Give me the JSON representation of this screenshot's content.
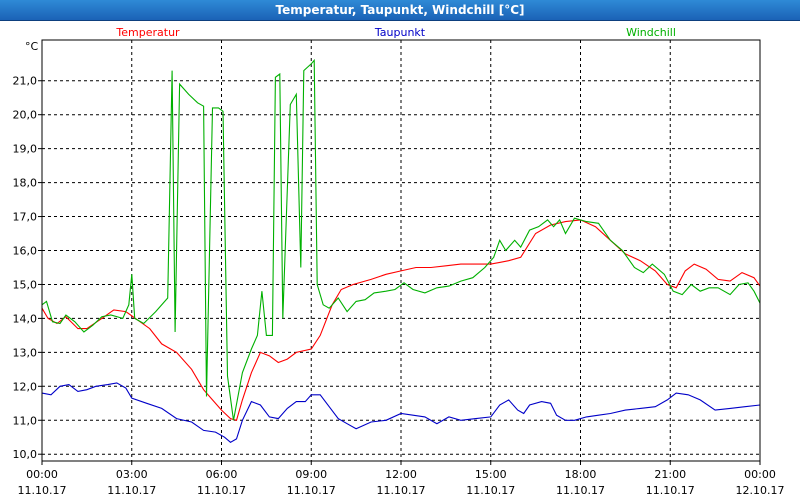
{
  "window": {
    "title": "Temperatur, Taupunkt, Windchill [°C]"
  },
  "chart_data": {
    "type": "line",
    "title": "Temperatur, Taupunkt, Windchill [°C]",
    "y_unit_label": "°C",
    "ylim": [
      9.8,
      22.2
    ],
    "xlim_hours": [
      0,
      24
    ],
    "y_ticks": [
      "10,0",
      "11,0",
      "12,0",
      "13,0",
      "14,0",
      "15,0",
      "16,0",
      "17,0",
      "18,0",
      "19,0",
      "20,0",
      "21,0"
    ],
    "x_ticks": [
      {
        "time": "00:00",
        "date": "11.10.17"
      },
      {
        "time": "03:00",
        "date": "11.10.17"
      },
      {
        "time": "06:00",
        "date": "11.10.17"
      },
      {
        "time": "09:00",
        "date": "11.10.17"
      },
      {
        "time": "12:00",
        "date": "11.10.17"
      },
      {
        "time": "15:00",
        "date": "11.10.17"
      },
      {
        "time": "18:00",
        "date": "11.10.17"
      },
      {
        "time": "21:00",
        "date": "11.10.17"
      },
      {
        "time": "00:00",
        "date": "12.10.17"
      }
    ],
    "grid": true,
    "series": [
      {
        "name": "Temperatur",
        "color": "#ff0000",
        "points": [
          [
            0.0,
            14.3
          ],
          [
            0.2,
            14.0
          ],
          [
            0.5,
            13.85
          ],
          [
            0.8,
            14.05
          ],
          [
            1.2,
            13.7
          ],
          [
            1.5,
            13.7
          ],
          [
            2.0,
            14.0
          ],
          [
            2.4,
            14.25
          ],
          [
            2.8,
            14.2
          ],
          [
            3.2,
            13.95
          ],
          [
            3.6,
            13.7
          ],
          [
            4.0,
            13.25
          ],
          [
            4.5,
            13.0
          ],
          [
            5.0,
            12.5
          ],
          [
            5.4,
            11.9
          ],
          [
            5.7,
            11.6
          ],
          [
            6.0,
            11.3
          ],
          [
            6.3,
            11.05
          ],
          [
            6.5,
            11.0
          ],
          [
            6.7,
            11.6
          ],
          [
            7.0,
            12.4
          ],
          [
            7.3,
            13.0
          ],
          [
            7.6,
            12.9
          ],
          [
            7.9,
            12.7
          ],
          [
            8.2,
            12.8
          ],
          [
            8.5,
            13.0
          ],
          [
            9.0,
            13.1
          ],
          [
            9.3,
            13.5
          ],
          [
            9.7,
            14.4
          ],
          [
            10.0,
            14.85
          ],
          [
            10.4,
            15.0
          ],
          [
            11.0,
            15.15
          ],
          [
            11.5,
            15.3
          ],
          [
            12.0,
            15.4
          ],
          [
            12.5,
            15.5
          ],
          [
            13.0,
            15.5
          ],
          [
            13.5,
            15.55
          ],
          [
            14.0,
            15.6
          ],
          [
            14.5,
            15.6
          ],
          [
            15.0,
            15.6
          ],
          [
            15.3,
            15.65
          ],
          [
            15.6,
            15.7
          ],
          [
            16.0,
            15.8
          ],
          [
            16.5,
            16.5
          ],
          [
            17.0,
            16.75
          ],
          [
            17.5,
            16.85
          ],
          [
            18.0,
            16.9
          ],
          [
            18.5,
            16.7
          ],
          [
            19.0,
            16.3
          ],
          [
            19.5,
            15.9
          ],
          [
            20.0,
            15.7
          ],
          [
            20.5,
            15.4
          ],
          [
            20.9,
            15.0
          ],
          [
            21.2,
            14.9
          ],
          [
            21.5,
            15.4
          ],
          [
            21.8,
            15.6
          ],
          [
            22.2,
            15.45
          ],
          [
            22.6,
            15.15
          ],
          [
            23.0,
            15.1
          ],
          [
            23.4,
            15.35
          ],
          [
            23.8,
            15.2
          ],
          [
            24.0,
            14.95
          ]
        ]
      },
      {
        "name": "Taupunkt",
        "color": "#0000c8",
        "points": [
          [
            0.0,
            11.8
          ],
          [
            0.3,
            11.75
          ],
          [
            0.6,
            12.0
          ],
          [
            0.9,
            12.05
          ],
          [
            1.2,
            11.85
          ],
          [
            1.5,
            11.9
          ],
          [
            1.8,
            12.0
          ],
          [
            2.2,
            12.05
          ],
          [
            2.5,
            12.1
          ],
          [
            2.8,
            11.95
          ],
          [
            3.0,
            11.65
          ],
          [
            3.5,
            11.5
          ],
          [
            4.0,
            11.35
          ],
          [
            4.5,
            11.05
          ],
          [
            5.0,
            10.95
          ],
          [
            5.4,
            10.7
          ],
          [
            5.8,
            10.65
          ],
          [
            6.1,
            10.5
          ],
          [
            6.3,
            10.35
          ],
          [
            6.5,
            10.45
          ],
          [
            6.7,
            11.0
          ],
          [
            7.0,
            11.55
          ],
          [
            7.3,
            11.45
          ],
          [
            7.6,
            11.1
          ],
          [
            7.9,
            11.05
          ],
          [
            8.2,
            11.35
          ],
          [
            8.5,
            11.55
          ],
          [
            8.8,
            11.55
          ],
          [
            9.0,
            11.75
          ],
          [
            9.3,
            11.75
          ],
          [
            9.6,
            11.4
          ],
          [
            9.9,
            11.05
          ],
          [
            10.2,
            10.9
          ],
          [
            10.5,
            10.75
          ],
          [
            11.0,
            10.95
          ],
          [
            11.5,
            11.0
          ],
          [
            12.0,
            11.2
          ],
          [
            12.4,
            11.15
          ],
          [
            12.8,
            11.1
          ],
          [
            13.2,
            10.9
          ],
          [
            13.6,
            11.1
          ],
          [
            14.0,
            11.0
          ],
          [
            14.5,
            11.05
          ],
          [
            15.0,
            11.1
          ],
          [
            15.3,
            11.45
          ],
          [
            15.6,
            11.6
          ],
          [
            15.9,
            11.3
          ],
          [
            16.1,
            11.2
          ],
          [
            16.3,
            11.45
          ],
          [
            16.7,
            11.55
          ],
          [
            17.0,
            11.5
          ],
          [
            17.2,
            11.15
          ],
          [
            17.5,
            11.0
          ],
          [
            17.8,
            11.0
          ],
          [
            18.2,
            11.1
          ],
          [
            18.6,
            11.15
          ],
          [
            19.0,
            11.2
          ],
          [
            19.5,
            11.3
          ],
          [
            20.0,
            11.35
          ],
          [
            20.5,
            11.4
          ],
          [
            20.9,
            11.6
          ],
          [
            21.2,
            11.8
          ],
          [
            21.6,
            11.75
          ],
          [
            22.0,
            11.6
          ],
          [
            22.5,
            11.3
          ],
          [
            23.0,
            11.35
          ],
          [
            23.5,
            11.4
          ],
          [
            24.0,
            11.45
          ]
        ]
      },
      {
        "name": "Windchill",
        "color": "#00b000",
        "points": [
          [
            0.0,
            14.4
          ],
          [
            0.15,
            14.5
          ],
          [
            0.35,
            13.9
          ],
          [
            0.6,
            13.85
          ],
          [
            0.8,
            14.1
          ],
          [
            1.1,
            13.9
          ],
          [
            1.4,
            13.6
          ],
          [
            1.7,
            13.8
          ],
          [
            2.0,
            14.05
          ],
          [
            2.3,
            14.1
          ],
          [
            2.7,
            14.0
          ],
          [
            2.9,
            14.4
          ],
          [
            3.0,
            15.3
          ],
          [
            3.1,
            14.0
          ],
          [
            3.4,
            13.85
          ],
          [
            3.8,
            14.2
          ],
          [
            4.2,
            14.6
          ],
          [
            4.35,
            21.3
          ],
          [
            4.45,
            13.6
          ],
          [
            4.6,
            20.9
          ],
          [
            4.9,
            20.6
          ],
          [
            5.2,
            20.35
          ],
          [
            5.4,
            20.25
          ],
          [
            5.5,
            11.7
          ],
          [
            5.7,
            20.2
          ],
          [
            5.9,
            20.2
          ],
          [
            6.05,
            20.1
          ],
          [
            6.2,
            12.3
          ],
          [
            6.4,
            11.0
          ],
          [
            6.7,
            12.4
          ],
          [
            7.0,
            13.1
          ],
          [
            7.2,
            13.5
          ],
          [
            7.35,
            14.8
          ],
          [
            7.5,
            13.5
          ],
          [
            7.7,
            13.5
          ],
          [
            7.8,
            21.1
          ],
          [
            7.95,
            21.2
          ],
          [
            8.05,
            14.0
          ],
          [
            8.3,
            20.3
          ],
          [
            8.5,
            20.6
          ],
          [
            8.65,
            15.5
          ],
          [
            8.75,
            21.3
          ],
          [
            9.0,
            21.5
          ],
          [
            9.1,
            21.6
          ],
          [
            9.2,
            15.0
          ],
          [
            9.4,
            14.4
          ],
          [
            9.6,
            14.3
          ],
          [
            9.9,
            14.6
          ],
          [
            10.2,
            14.2
          ],
          [
            10.5,
            14.5
          ],
          [
            10.8,
            14.55
          ],
          [
            11.1,
            14.75
          ],
          [
            11.5,
            14.8
          ],
          [
            11.8,
            14.85
          ],
          [
            12.1,
            15.05
          ],
          [
            12.4,
            14.85
          ],
          [
            12.8,
            14.75
          ],
          [
            13.2,
            14.9
          ],
          [
            13.6,
            14.95
          ],
          [
            14.0,
            15.1
          ],
          [
            14.4,
            15.2
          ],
          [
            14.8,
            15.5
          ],
          [
            15.1,
            15.8
          ],
          [
            15.3,
            16.3
          ],
          [
            15.5,
            16.0
          ],
          [
            15.8,
            16.3
          ],
          [
            16.0,
            16.1
          ],
          [
            16.3,
            16.6
          ],
          [
            16.6,
            16.7
          ],
          [
            16.9,
            16.9
          ],
          [
            17.1,
            16.7
          ],
          [
            17.3,
            16.9
          ],
          [
            17.5,
            16.5
          ],
          [
            17.8,
            16.95
          ],
          [
            18.2,
            16.85
          ],
          [
            18.6,
            16.8
          ],
          [
            19.0,
            16.3
          ],
          [
            19.4,
            16.0
          ],
          [
            19.8,
            15.5
          ],
          [
            20.1,
            15.35
          ],
          [
            20.4,
            15.6
          ],
          [
            20.8,
            15.3
          ],
          [
            21.1,
            14.8
          ],
          [
            21.4,
            14.7
          ],
          [
            21.7,
            15.0
          ],
          [
            22.0,
            14.8
          ],
          [
            22.3,
            14.9
          ],
          [
            22.6,
            14.9
          ],
          [
            23.0,
            14.7
          ],
          [
            23.3,
            15.0
          ],
          [
            23.6,
            15.05
          ],
          [
            23.8,
            14.8
          ],
          [
            24.0,
            14.45
          ]
        ]
      }
    ]
  }
}
